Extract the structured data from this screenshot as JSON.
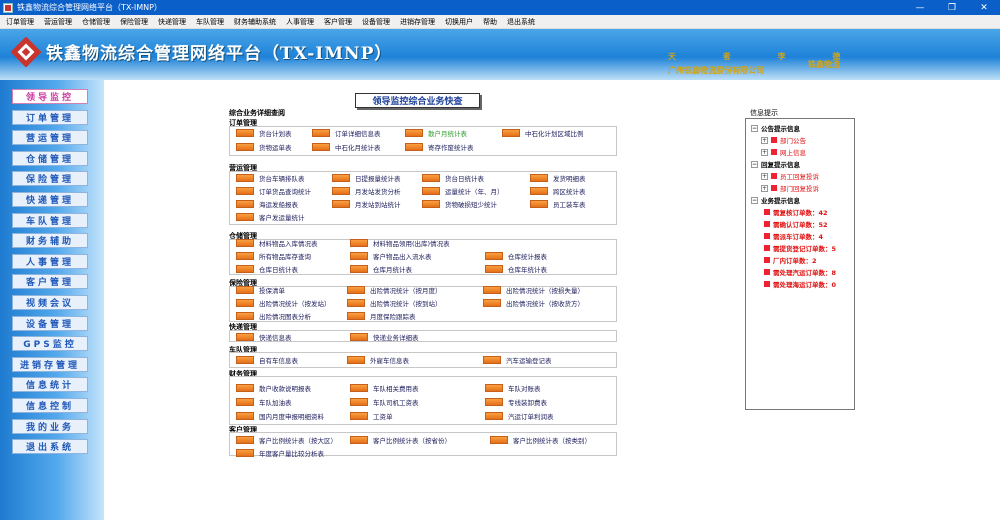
{
  "window": {
    "title": "铁鑫物流综合管理网络平台（TX-IMNP）"
  },
  "menu": [
    "订单管理",
    "营运管理",
    "仓储管理",
    "保险管理",
    "快递管理",
    "车队管理",
    "财务辅助系统",
    "人事管理",
    "客户管理",
    "设备管理",
    "进销存管理",
    "切换用户",
    "帮助",
    "退出系统"
  ],
  "banner": {
    "title": "铁鑫物流综合管理网络平台（TX-IMNP）",
    "slogan": "天 者 李 德",
    "company": "广州铁鑫物流股份有限公司",
    "brand": "铁鑫物流"
  },
  "sidebar": [
    "领导监控",
    "订单管理",
    "营运管理",
    "仓储管理",
    "保险管理",
    "快递管理",
    "车队管理",
    "财务辅助",
    "人事管理",
    "客户管理",
    "视频会议",
    "设备管理",
    "GPS监控",
    "进销存管理",
    "信息统计",
    "信息控制",
    "我的业务",
    "退出系统"
  ],
  "main": {
    "headline": "领导监控综合业务快查",
    "content_title": "综合业务详细查阅",
    "sections": [
      {
        "title": "订单管理",
        "items": [
          "货台计划表",
          "订单详细信息表",
          "散户月统计表",
          "中石化计划区域比例",
          "货物运单表",
          "中石化月统计表",
          "寄存作废统计表"
        ]
      },
      {
        "title": "营运管理",
        "items": [
          "货台车辆排队表",
          "日提报量统计表",
          "货台日统计表",
          "发货明细表",
          "订单货品查询统计",
          "月发站发货分析",
          "运量统计（年、月）",
          "跨区统计表",
          "海运发船报表",
          "月发站到站统计",
          "货物破损短少统计",
          "员工装车表",
          "客户发运量统计"
        ]
      },
      {
        "title": "仓储管理",
        "items": [
          "材料物品入库情况表",
          "材料物品领用(出库)情况表",
          "所有物品库存查询",
          "客户物品出入流水表",
          "仓库统计报表",
          "仓库日统计表",
          "仓库月统计表",
          "仓库年统计表"
        ]
      },
      {
        "title": "保险管理",
        "items": [
          "投保清单",
          "出险情况统计（按月度）",
          "出险情况统计（按损失量）",
          "出险情况统计（按发站）",
          "出险情况统计（按到站）",
          "出险情况统计（按收货方）",
          "出险情况图表分析",
          "月度保险跟踪表"
        ]
      },
      {
        "title": "快递管理",
        "items": [
          "快递信息表",
          "快递业务详细表"
        ]
      },
      {
        "title": "车队管理",
        "items": [
          "自有车信息表",
          "外雇车信息表",
          "汽车运输登记表"
        ]
      },
      {
        "title": "财务管理",
        "items": [
          "散户收款说明报表",
          "车队相关费用表",
          "车队对账表",
          "车队加油表",
          "车队司机工资表",
          "专线装卸费表",
          "国内月度申报明细资料",
          "工资单",
          "汽运订单利润表"
        ]
      },
      {
        "title": "客户管理",
        "items": [
          "客户比例统计表（按大区）",
          "客户比例统计表（按省份）",
          "客户比例统计表（按类别）",
          "年度客户量比较分析表"
        ]
      }
    ]
  },
  "info": {
    "title": "信息提示",
    "groups": [
      {
        "label": "公告提示信息",
        "children": [
          "部门公告",
          "网上信息"
        ]
      },
      {
        "label": "回复提示信息",
        "children": [
          "员工回复投诉",
          "部门回复投诉"
        ]
      },
      {
        "label": "业务提示信息",
        "children": [
          "需复核订单数：42",
          "需确认订单数：52",
          "需派车订单数：4",
          "需提货登记订单数：5",
          "厂内订单数：2",
          "需处理汽运订单数：8",
          "需处理海运订单数：0"
        ]
      }
    ]
  },
  "colors": {
    "menu_blue": "#1f58b8",
    "active_pink": "#cc3ea0",
    "order_icon": "#f08a30",
    "alert_red": "#e01010",
    "banner_blue": "#1e82d8"
  }
}
